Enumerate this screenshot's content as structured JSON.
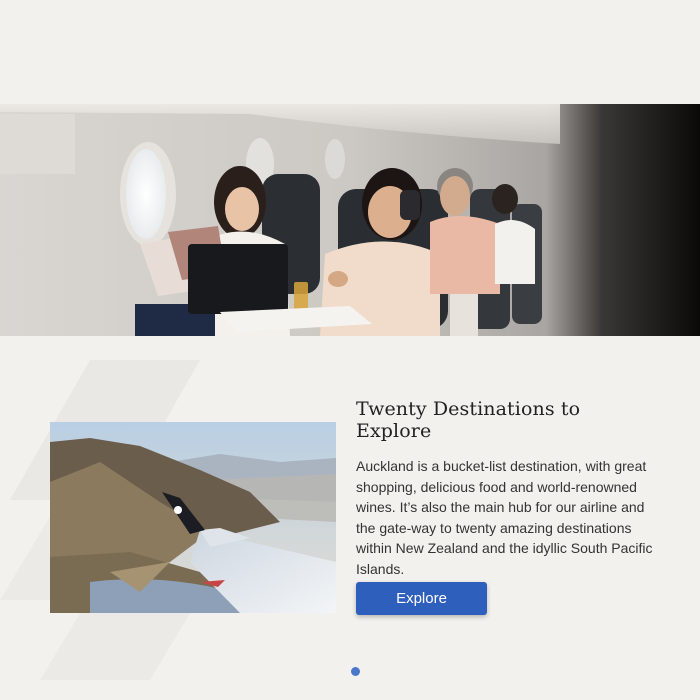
{
  "hero": {
    "image_name": "airplane-cabin-passengers-photo"
  },
  "feature": {
    "image_name": "new-zealand-mountains-wing-photo",
    "title": "Twenty Destinations to Explore",
    "body": "Auckland is a bucket-list destination, with great shopping, delicious food and world-renowned wines. It’s also the main hub for our airline and the gate-way to twenty amazing destinations within New Zealand and the idyllic South Pacific Islands.",
    "button_label": "Explore"
  },
  "carousel": {
    "active_index": 1,
    "total": 1
  },
  "colors": {
    "background": "#f2f1ee",
    "accent": "#2f5fbd",
    "dot": "#4a78c9"
  }
}
